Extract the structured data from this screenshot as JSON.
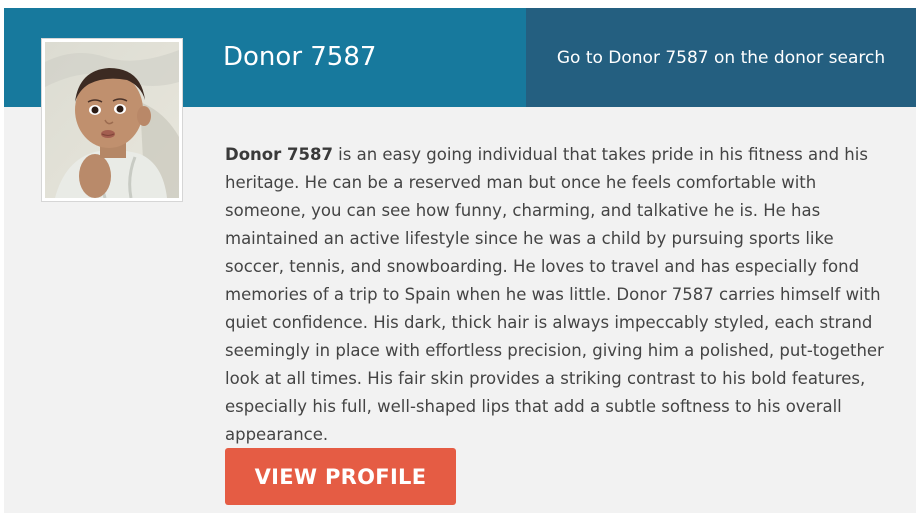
{
  "header": {
    "title": "Donor 7587",
    "search_link": "Go to Donor 7587 on the donor search"
  },
  "profile": {
    "photo_alt": "Baby photo of Donor 7587",
    "bio_name": "Donor 7587",
    "bio_text": " is an easy going individual that takes pride in his fitness and his heritage. He can be a reserved man but once he feels comfortable with someone, you can see how funny, charming, and talkative he is. He has maintained an active lifestyle since he was a child by pursuing sports like soccer, tennis, and snowboarding. He loves to travel and has especially fond memories of a trip to Spain when he was little. Donor 7587 carries himself with quiet confidence. His dark, thick hair is always impeccably styled, each strand seemingly in place with effortless precision, giving him a polished, put-together look at all times. His fair skin provides a striking contrast to his bold features, especially his full, well-shaped lips that add a subtle softness to his overall appearance."
  },
  "actions": {
    "view_profile_label": "VIEW PROFILE"
  },
  "colors": {
    "header_left": "#17799d",
    "header_right": "#245f80",
    "card_background": "#f2f2f2",
    "button": "#e55c44"
  }
}
